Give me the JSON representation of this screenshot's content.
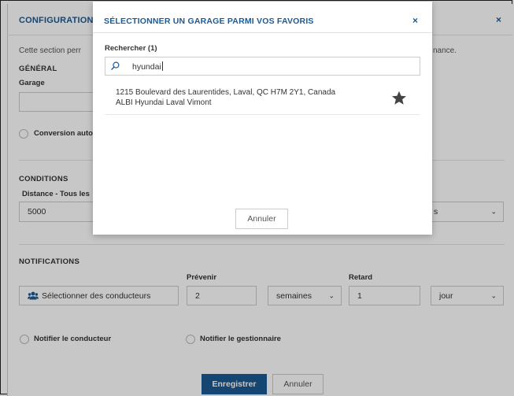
{
  "background": {
    "title": "CONFIGURATION",
    "close": "×",
    "intro_text": "Cette section perr",
    "intro_tail": "nance.",
    "general": {
      "heading": "GÉNÉRAL",
      "garage_label": "Garage",
      "conversion_label": "Conversion auto"
    },
    "conditions": {
      "heading": "CONDITIONS",
      "distance_label": "Distance - Tous les",
      "distance_value": "5000",
      "unit_partial": "s"
    },
    "notifications": {
      "heading": "NOTIFICATIONS",
      "select_drivers_button": "Sélectionner des conducteurs",
      "prevenir_label": "Prévenir",
      "prevenir_value": "2",
      "prevenir_unit": "semaines",
      "retard_label": "Retard",
      "retard_value": "1",
      "retard_unit": "jour",
      "notify_driver_label": "Notifier le conducteur",
      "notify_manager_label": "Notifier le gestionnaire"
    },
    "footer": {
      "save_label": "Enregistrer",
      "cancel_label": "Annuler"
    }
  },
  "favorites_modal": {
    "title": "SÉLECTIONNER UN GARAGE PARMI VOS FAVORIS",
    "close": "×",
    "search_label": "Rechercher (1)",
    "search_value": "hyundai",
    "results": [
      {
        "address": "1215 Boulevard des Laurentides, Laval, QC H7M 2Y1, Canada",
        "name": "ALBI Hyundai Laval Vimont",
        "favorite_icon": "star-icon"
      }
    ],
    "cancel_label": "Annuler"
  },
  "colors": {
    "accent": "#1c5a93",
    "star": "#444444"
  }
}
